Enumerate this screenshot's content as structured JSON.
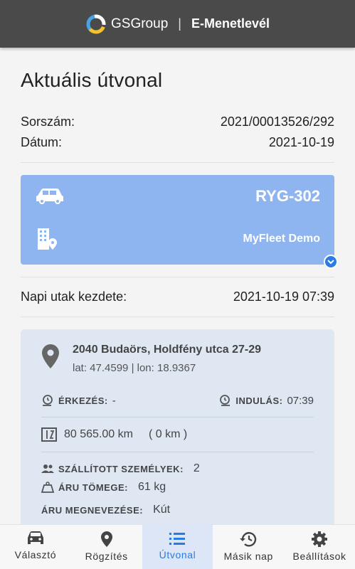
{
  "header": {
    "brand": "GSGroup",
    "separator": "|",
    "app_name": "E-Menetlevél"
  },
  "page": {
    "title": "Aktuális útvonal"
  },
  "info": {
    "serial_label": "Sorszám:",
    "serial_value": "2021/00013526/292",
    "date_label": "Dátum:",
    "date_value": "2021-10-19"
  },
  "vehicle": {
    "plate": "RYG-302",
    "fleet": "MyFleet Demo",
    "car_icon": "car-icon",
    "building_icon": "building-location-icon"
  },
  "daily_start": {
    "label": "Napi utak kezdete:",
    "value": "2021-10-19 07:39"
  },
  "stop": {
    "address": "2040 Budaörs, Holdfény utca 27-29",
    "coords": "lat: 47.4599 | lon: 18.9367",
    "arrival_label": "ÉRKEZÉS:",
    "arrival_value": "-",
    "departure_label": "INDULÁS:",
    "departure_value": "07:39",
    "odometer": "80 565.00 km",
    "odometer_delta": "( 0 km )",
    "passengers_label": "SZÁLLÍTOTT SZEMÉLYEK:",
    "passengers_value": "2",
    "cargo_weight_label": "ÁRU TÖMEGE:",
    "cargo_weight_value": "61 kg",
    "cargo_name_label": "ÁRU MEGNEVEZÉSE:",
    "cargo_name_value": "Kút"
  },
  "nav": [
    {
      "label": "Választó",
      "icon": "car-icon"
    },
    {
      "label": "Rögzítés",
      "icon": "location-pin-icon"
    },
    {
      "label": "Útvonal",
      "icon": "list-icon",
      "active": true
    },
    {
      "label": "Másik nap",
      "icon": "history-icon"
    },
    {
      "label": "Beállítások",
      "icon": "gear-icon"
    }
  ],
  "colors": {
    "accent": "#2a7be4",
    "topbar": "#4a4a4a",
    "vehicle_card": "#8fb5f0",
    "stop_card": "#dfe7f3"
  }
}
